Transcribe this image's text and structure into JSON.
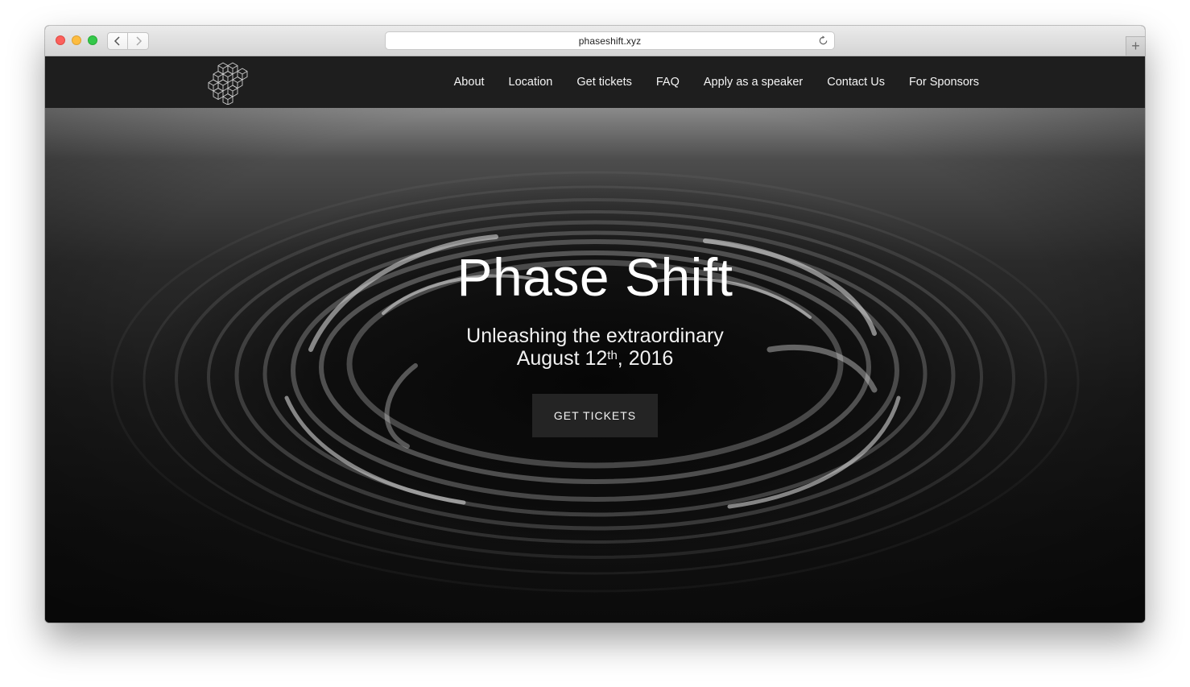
{
  "browser": {
    "url": "phaseshift.xyz",
    "back_icon": "chevron-left-icon",
    "forward_icon": "chevron-right-icon",
    "reload_icon": "reload-icon",
    "new_tab_label": "+"
  },
  "site": {
    "logo_icon": "cube-cluster-logo",
    "nav": [
      "About",
      "Location",
      "Get tickets",
      "FAQ",
      "Apply as a speaker",
      "Contact Us",
      "For Sponsors"
    ]
  },
  "hero": {
    "title": "Phase Shift",
    "tagline": "Unleashing the extraordinary",
    "date_prefix": "August 12",
    "date_sup": "th",
    "date_suffix": ", 2016",
    "cta_label": "GET TICKETS"
  },
  "colors": {
    "header_bg": "#1e1e1e",
    "cta_bg": "#242424",
    "close": "#fc605c",
    "minimize": "#fdbc40",
    "maximize": "#34c84a"
  }
}
